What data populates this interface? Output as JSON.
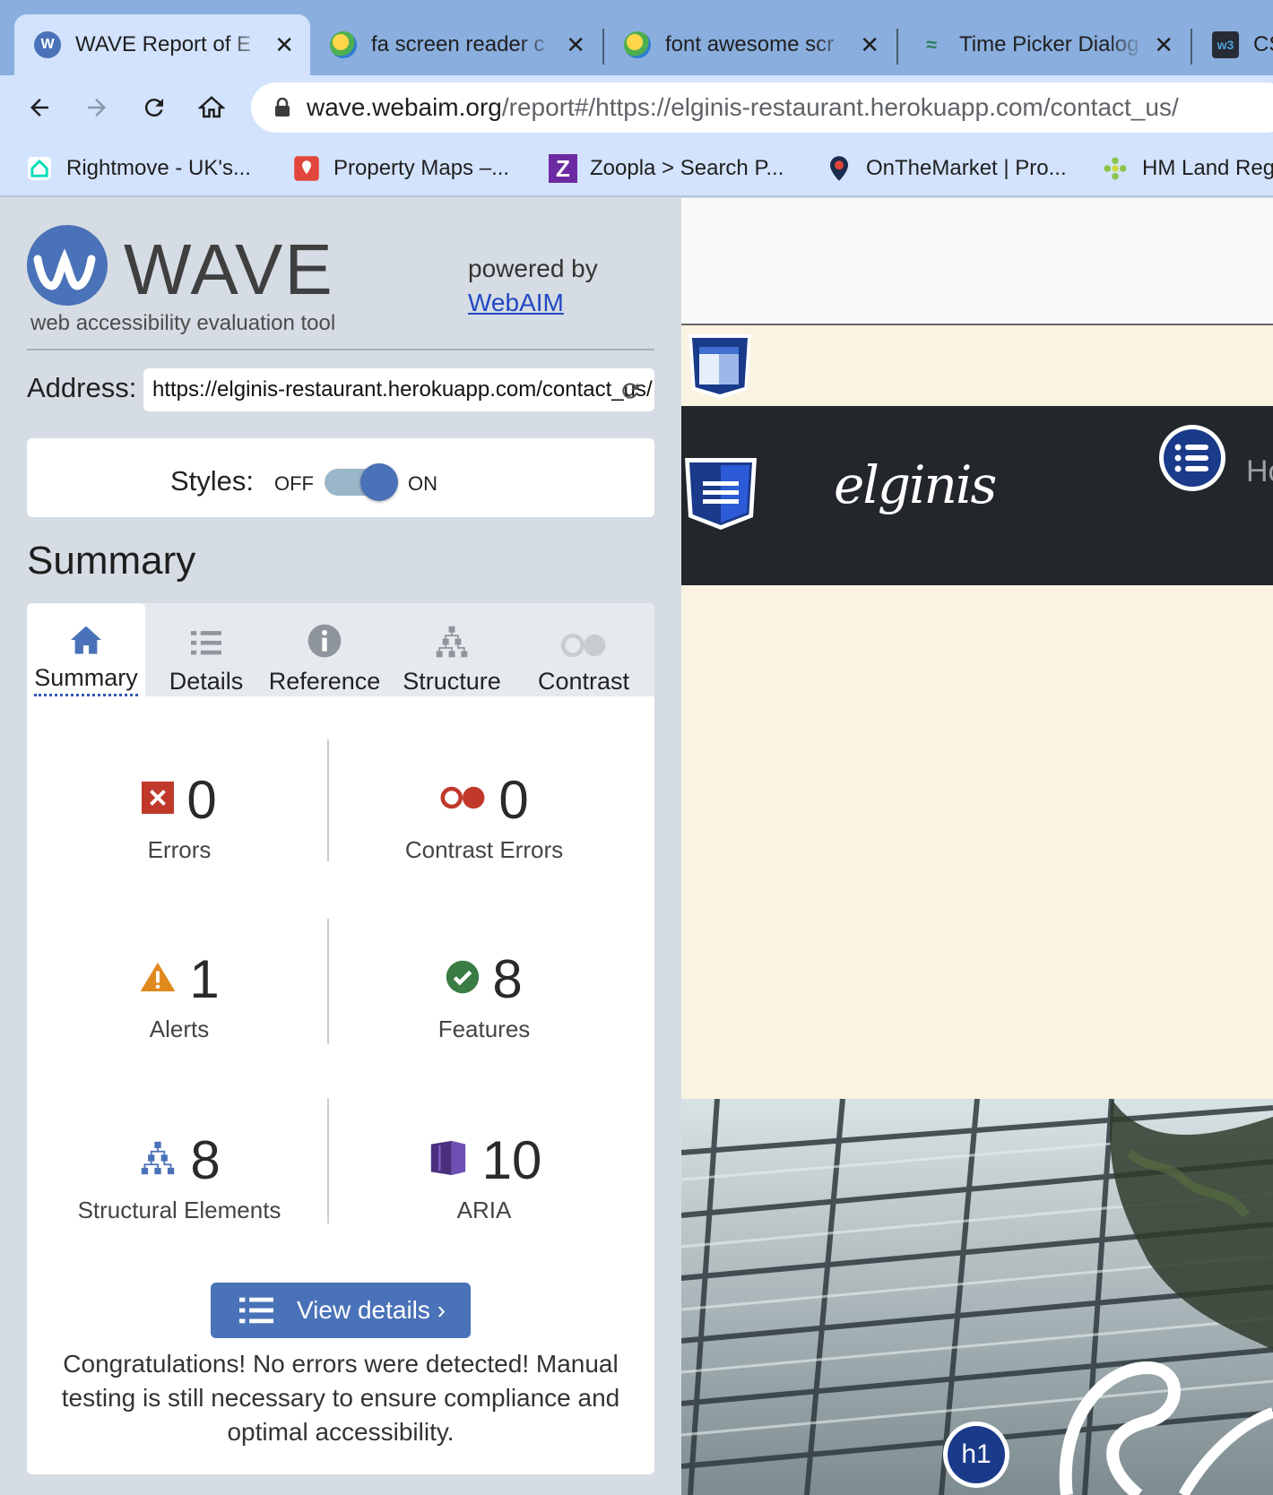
{
  "browser": {
    "tabs": [
      {
        "title": "WAVE Report of E",
        "active": true,
        "icon": "wave-favicon"
      },
      {
        "title": "fa screen reader c",
        "active": false,
        "icon": "globe-favicon"
      },
      {
        "title": "font awesome scr",
        "active": false,
        "icon": "globe-favicon"
      },
      {
        "title": "Time Picker Dialog",
        "active": false,
        "icon": "angular-material-favicon"
      },
      {
        "title": "CS",
        "active": false,
        "icon": "w3schools-favicon"
      }
    ],
    "url_host": "wave.webaim.org",
    "url_path": "/report#/https://elginis-restaurant.herokuapp.com/contact_us/",
    "bookmarks": [
      {
        "label": "Rightmove - UK's...",
        "icon": "house-icon"
      },
      {
        "label": "Property Maps –...",
        "icon": "map-pin-icon"
      },
      {
        "label": "Zoopla > Search P...",
        "icon": "zoopla-icon"
      },
      {
        "label": "OnTheMarket | Pro...",
        "icon": "location-pin-icon"
      },
      {
        "label": "HM Land Reg",
        "icon": "land-registry-icon"
      }
    ]
  },
  "wave": {
    "brand_title": "WAVE",
    "brand_subtitle": "web accessibility evaluation tool",
    "powered_by": "powered by",
    "webaim_link": "WebAIM",
    "address_label": "Address:",
    "address_value": "https://elginis-restaurant.herokuapp.com/contact_us/",
    "styles_label": "Styles:",
    "styles_off": "OFF",
    "styles_on": "ON",
    "styles_enabled": true,
    "summary_heading": "Summary",
    "tabs": [
      {
        "label": "Summary",
        "icon": "home-icon",
        "active": true
      },
      {
        "label": "Details",
        "icon": "list-icon",
        "active": false
      },
      {
        "label": "Reference",
        "icon": "info-icon",
        "active": false
      },
      {
        "label": "Structure",
        "icon": "structure-icon",
        "active": false
      },
      {
        "label": "Contrast",
        "icon": "contrast-icon",
        "active": false
      }
    ],
    "stats": {
      "errors": {
        "value": "0",
        "label": "Errors"
      },
      "contrast_errors": {
        "value": "0",
        "label": "Contrast Errors"
      },
      "alerts": {
        "value": "1",
        "label": "Alerts"
      },
      "features": {
        "value": "8",
        "label": "Features"
      },
      "structural": {
        "value": "8",
        "label": "Structural Elements"
      },
      "aria": {
        "value": "10",
        "label": "ARIA"
      }
    },
    "view_details": "View details ›",
    "congrats": "Congratulations! No errors were detected! Manual testing is still necessary to ensure compliance and optimal accessibility."
  },
  "preview": {
    "logo_text": "elginis",
    "nav_partial_text": "Ho",
    "heading_badge": "h1"
  },
  "colors": {
    "wave_blue": "#4a72b8",
    "error_red": "#c0392b",
    "alert_orange": "#e08a1e",
    "feature_green": "#3a7d44",
    "aria_purple": "#4a2f7f",
    "nav_dark": "#23262b",
    "page_cream": "#faf3e1"
  }
}
